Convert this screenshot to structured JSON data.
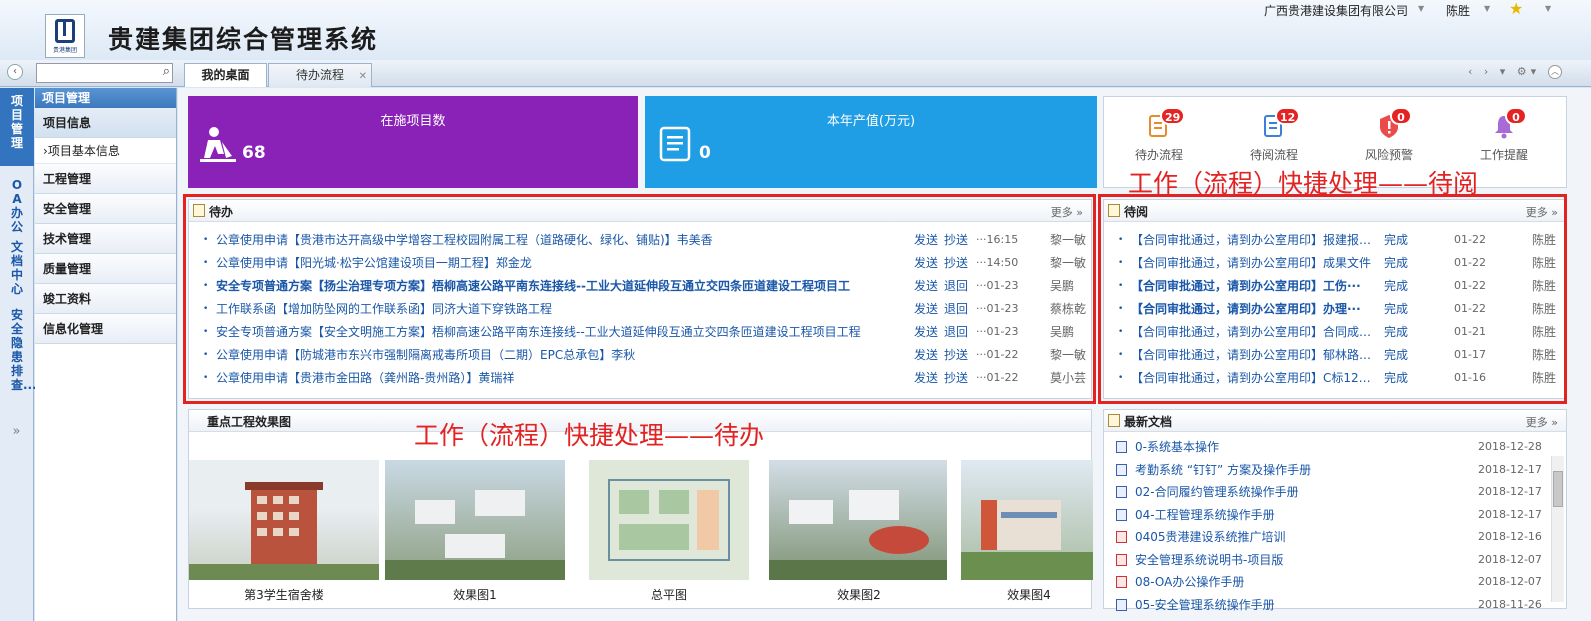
{
  "header": {
    "title": "贵建集团综合管理系统",
    "logo_caption": "贵港集团",
    "company": "广西贵港建设集团有限公司",
    "user": "陈胜"
  },
  "search": {
    "placeholder": ""
  },
  "tabs": [
    {
      "label": "我的桌面"
    },
    {
      "label": "待办流程"
    }
  ],
  "left_nav": [
    "项目管理",
    "OA办公",
    "文档中心",
    "安全隐患排查..."
  ],
  "sub_nav": {
    "head": "项目管理",
    "groups": [
      {
        "label": "项目信息",
        "children": [
          "项目基本信息"
        ]
      },
      {
        "label": "工程管理"
      },
      {
        "label": "安全管理"
      },
      {
        "label": "技术管理"
      },
      {
        "label": "质量管理"
      },
      {
        "label": "竣工资料"
      },
      {
        "label": "信息化管理"
      }
    ]
  },
  "stats": [
    {
      "label": "在施项目数",
      "value": "68",
      "color": "#8a22b7"
    },
    {
      "label": "本年产值(万元)",
      "value": "0",
      "color": "#1f9de5"
    }
  ],
  "badges": [
    {
      "label": "待办流程",
      "count": "29"
    },
    {
      "label": "待阅流程",
      "count": "12"
    },
    {
      "label": "风险预警",
      "count": "0"
    },
    {
      "label": "工作提醒",
      "count": "0"
    }
  ],
  "todo": {
    "title": "待办",
    "more": "更多 »",
    "rows": [
      {
        "text": "公章使用申请【贵港市达开高级中学增容工程校园附属工程（道路硬化、绿化、铺贴)】韦美香",
        "a1": "发送",
        "a2": "抄送",
        "time": "···16:15",
        "who": "黎一敏",
        "bold": false
      },
      {
        "text": "公章使用申请【阳光城·松宇公馆建设项目一期工程】郑金龙",
        "a1": "发送",
        "a2": "抄送",
        "time": "···14:50",
        "who": "黎一敏",
        "bold": false
      },
      {
        "text": "安全专项普通方案【扬尘治理专项方案】梧柳高速公路平南东连接线--工业大道延伸段互通立交四条匝道建设工程项目工",
        "a1": "发送",
        "a2": "退回",
        "time": "···01-23",
        "who": "吴鹏",
        "bold": true
      },
      {
        "text": "工作联系函【增加防坠网的工作联系函】同济大道下穿铁路工程",
        "a1": "发送",
        "a2": "退回",
        "time": "···01-23",
        "who": "蔡栋乾",
        "bold": false
      },
      {
        "text": "安全专项普通方案【安全文明施工方案】梧柳高速公路平南东连接线--工业大道延伸段互通立交四条匝道建设工程项目工程",
        "a1": "发送",
        "a2": "退回",
        "time": "···01-23",
        "who": "吴鹏",
        "bold": false
      },
      {
        "text": "公章使用申请【防城港市东兴市强制隔离戒毒所项目（二期）EPC总承包】李秋",
        "a1": "发送",
        "a2": "抄送",
        "time": "···01-22",
        "who": "黎一敏",
        "bold": false
      },
      {
        "text": "公章使用申请【贵港市金田路（龚州路-贵州路）】黄瑞祥",
        "a1": "发送",
        "a2": "抄送",
        "time": "···01-22",
        "who": "莫小芸",
        "bold": false
      }
    ]
  },
  "toread": {
    "title": "待阅",
    "more": "更多 »",
    "rows": [
      {
        "text": "【合同审批通过，请到办公室用印】报建报监···",
        "status": "完成",
        "time": "01-22",
        "who": "陈胜",
        "bold": false
      },
      {
        "text": "【合同审批通过，请到办公室用印】成果文件",
        "status": "完成",
        "time": "01-22",
        "who": "陈胜",
        "bold": false
      },
      {
        "text": "【合同审批通过，请到办公室用印】工伤···",
        "status": "完成",
        "time": "01-22",
        "who": "陈胜",
        "bold": true
      },
      {
        "text": "【合同审批通过，请到办公室用印】办理···",
        "status": "完成",
        "time": "01-22",
        "who": "陈胜",
        "bold": true
      },
      {
        "text": "【合同审批通过，请到办公室用印】合同成果···",
        "status": "完成",
        "time": "01-21",
        "who": "陈胜",
        "bold": false
      },
      {
        "text": "【合同审批通过，请到办公室用印】郁林路小···",
        "status": "完成",
        "time": "01-17",
        "who": "陈胜",
        "bold": false
      },
      {
        "text": "【合同审批通过，请到办公室用印】C标12所···",
        "status": "完成",
        "time": "01-16",
        "who": "陈胜",
        "bold": false
      }
    ]
  },
  "gallery": {
    "title": "重点工程效果图",
    "items": [
      "第3学生宿舍楼",
      "效果图1",
      "总平图",
      "效果图2",
      "效果图4"
    ]
  },
  "docs": {
    "title": "最新文档",
    "more": "更多 »",
    "rows": [
      {
        "text": "0-系统基本操作",
        "date": "2018-12-28",
        "type": "doc"
      },
      {
        "text": "考勤系统 “钉钉” 方案及操作手册",
        "date": "2018-12-17",
        "type": "doc"
      },
      {
        "text": "02-合同履约管理系统操作手册",
        "date": "2018-12-17",
        "type": "doc"
      },
      {
        "text": "04-工程管理系统操作手册",
        "date": "2018-12-17",
        "type": "doc"
      },
      {
        "text": "0405贵港建设系统推广培训",
        "date": "2018-12-16",
        "type": "pdf"
      },
      {
        "text": "安全管理系统说明书-项目版",
        "date": "2018-12-07",
        "type": "pdf"
      },
      {
        "text": "08-OA办公操作手册",
        "date": "2018-12-07",
        "type": "pdf"
      },
      {
        "text": "05-安全管理系统操作手册",
        "date": "2018-11-26",
        "type": "doc"
      }
    ]
  },
  "annotations": {
    "toread": "工作（流程）快捷处理——待阅",
    "todo": "工作（流程）快捷处理——待办"
  }
}
